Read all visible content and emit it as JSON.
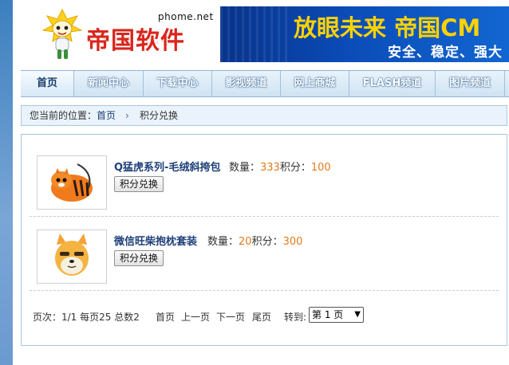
{
  "header": {
    "logo_domain": "phome.net",
    "logo_text": "帝国软件",
    "banner_title": "放眼未来 帝国CM",
    "banner_subtitle": "安全、稳定、强大"
  },
  "nav": {
    "items": [
      {
        "label": "首页",
        "active": true
      },
      {
        "label": "新闻中心"
      },
      {
        "label": "下载中心"
      },
      {
        "label": "影视频道"
      },
      {
        "label": "网上商城"
      },
      {
        "label": "FLASH频道"
      },
      {
        "label": "图片频道"
      }
    ]
  },
  "breadcrumb": {
    "prefix": "您当前的位置：",
    "home": "首页",
    "separator": "›",
    "current": "积分兑换"
  },
  "items": [
    {
      "name": "Q猛虎系列-毛绒斜挎包",
      "qty_label": "数量：",
      "qty": "333",
      "points_label": "积分：",
      "points": "100",
      "button": "积分兑换",
      "thumb_icon": "tiger-plush-bag-icon"
    },
    {
      "name": "微信旺柴抱枕套装",
      "qty_label": "数量：",
      "qty": "20",
      "points_label": "积分：",
      "points": "300",
      "button": "积分兑换",
      "thumb_icon": "shiba-dog-pillow-icon"
    }
  ],
  "pager": {
    "info": "页次：1/1 每页25 总数2",
    "first": "首页",
    "prev": "上一页",
    "next": "下一页",
    "last": "尾页",
    "goto": "转到:",
    "selected_page": "第 1 页"
  },
  "colors": {
    "accent_orange": "#e07b1e",
    "link_blue": "#1e3f7a",
    "logo_red": "#d8261c",
    "banner_yellow": "#ffd200"
  }
}
